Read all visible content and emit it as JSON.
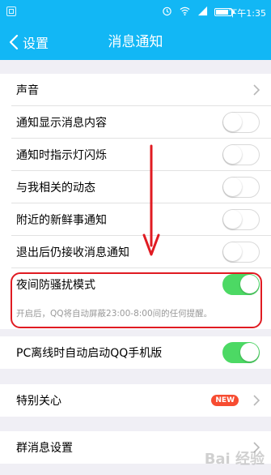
{
  "status_bar": {
    "time": "下午1:35",
    "icons": [
      "screen-icon",
      "alarm-icon",
      "wifi-icon",
      "signal-icon",
      "battery-icon"
    ]
  },
  "nav": {
    "back_label": "设置",
    "title": "消息通知"
  },
  "settings": {
    "sound": {
      "label": "声音"
    },
    "toggles": [
      {
        "label": "通知显示消息内容",
        "on": false
      },
      {
        "label": "通知时指示灯闪烁",
        "on": false
      },
      {
        "label": "与我相关的动态",
        "on": false
      },
      {
        "label": "附近的新鲜事通知",
        "on": false
      },
      {
        "label": "退出后仍接收消息通知",
        "on": false
      }
    ],
    "night_mode": {
      "label": "夜间防骚扰模式",
      "on": true,
      "hint": "开启后，QQ将自动屏蔽23:00-8:00间的任何提醒。"
    },
    "pc_offline": {
      "label": "PC离线时自动启动QQ手机版",
      "on": true
    },
    "special_care": {
      "label": "特别关心",
      "badge": "NEW"
    },
    "group_settings": {
      "label": "群消息设置"
    }
  },
  "watermark": "Bai 经验",
  "colors": {
    "header": "#12b7f5",
    "toggle_on": "#4cd964",
    "highlight": "#e01b22",
    "badge": "#f74c31"
  }
}
